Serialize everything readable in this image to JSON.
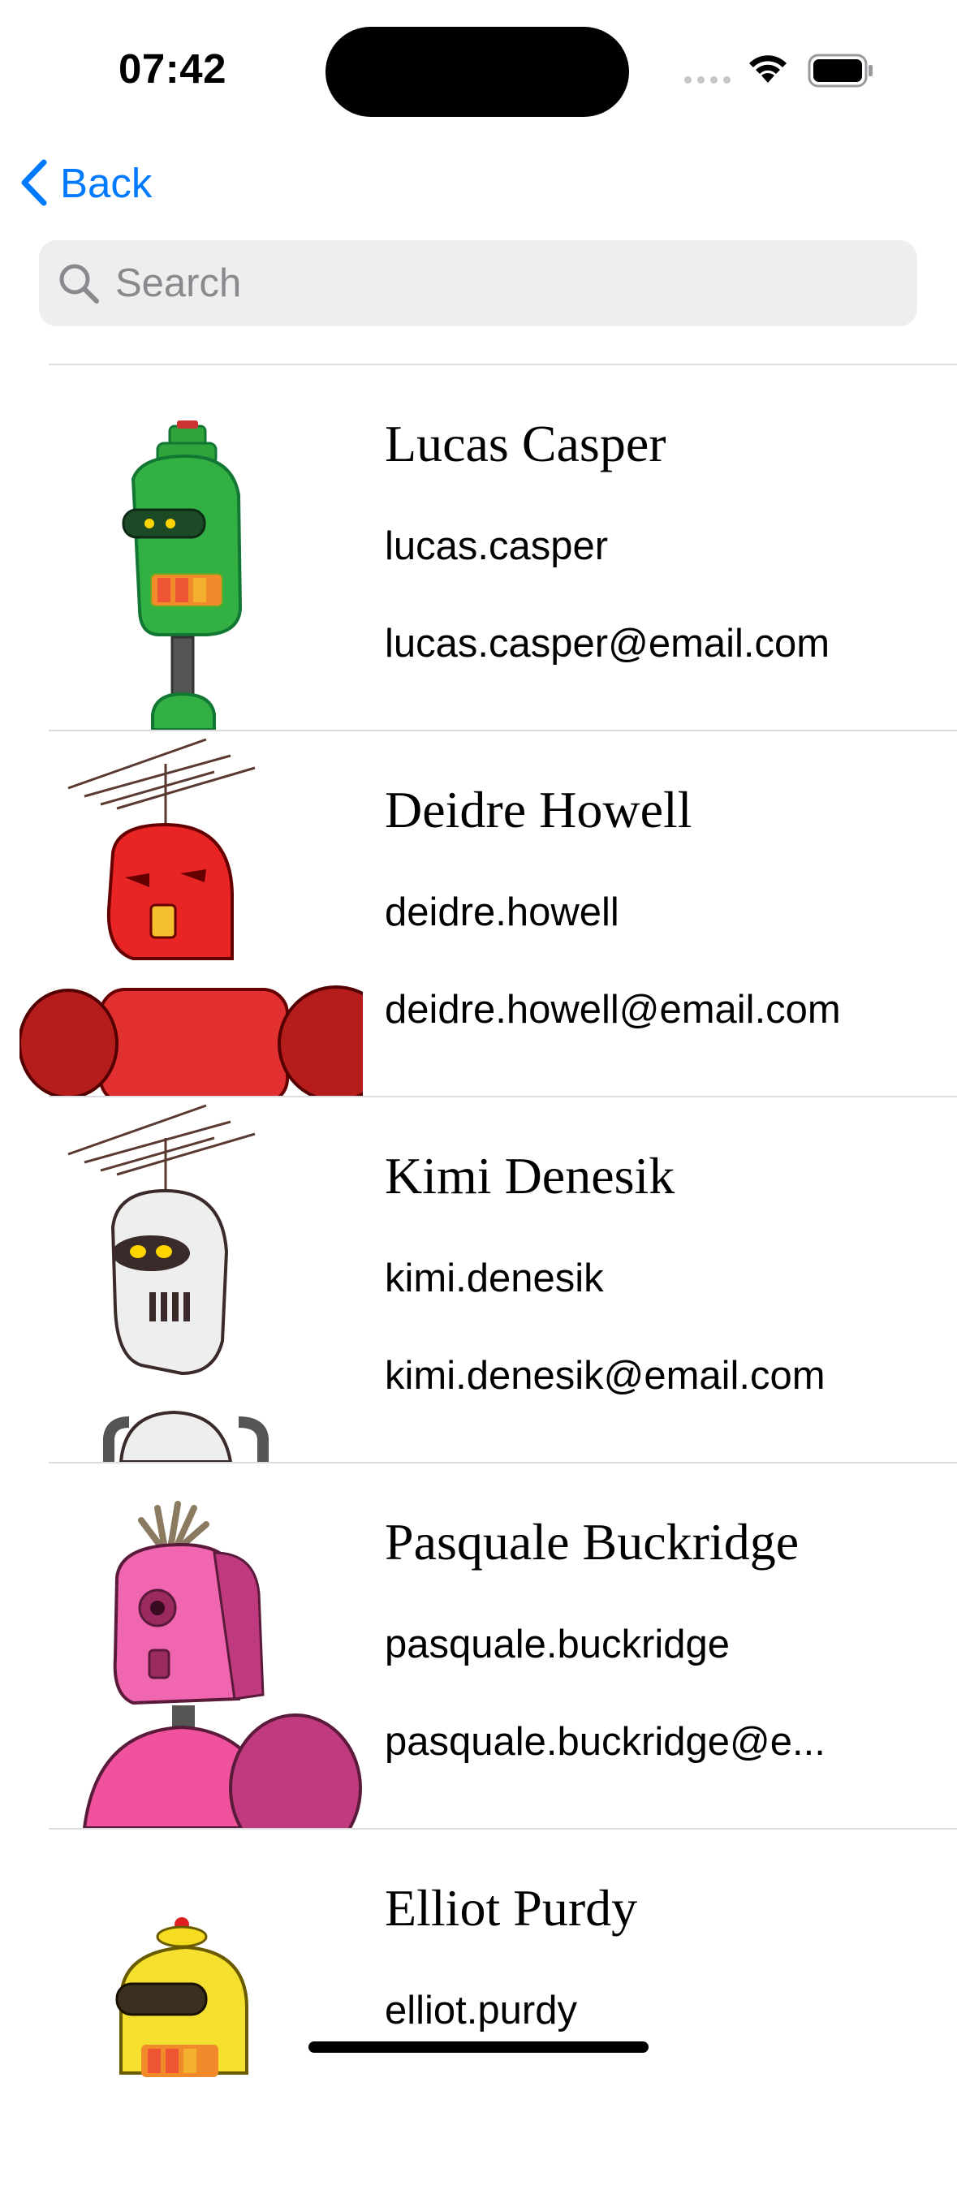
{
  "status_bar": {
    "time": "07:42"
  },
  "nav": {
    "back_label": "Back"
  },
  "search": {
    "placeholder": "Search",
    "value": ""
  },
  "contacts": [
    {
      "name": "Lucas Casper",
      "username": "lucas.casper",
      "email": "lucas.casper@email.com",
      "avatar": "green-robot-avatar"
    },
    {
      "name": "Deidre Howell",
      "username": "deidre.howell",
      "email": "deidre.howell@email.com",
      "avatar": "red-robot-avatar"
    },
    {
      "name": "Kimi Denesik",
      "username": "kimi.denesik",
      "email": "kimi.denesik@email.com",
      "avatar": "white-robot-avatar"
    },
    {
      "name": "Pasquale Buckridge",
      "username": "pasquale.buckridge",
      "email": "pasquale.buckridge@e...",
      "avatar": "pink-robot-avatar"
    },
    {
      "name": "Elliot Purdy",
      "username": "elliot.purdy",
      "email": "",
      "avatar": "yellow-robot-avatar"
    }
  ],
  "colors": {
    "accent": "#007aff",
    "separator": "#dcdcde",
    "search_bg": "#eeeeef"
  }
}
